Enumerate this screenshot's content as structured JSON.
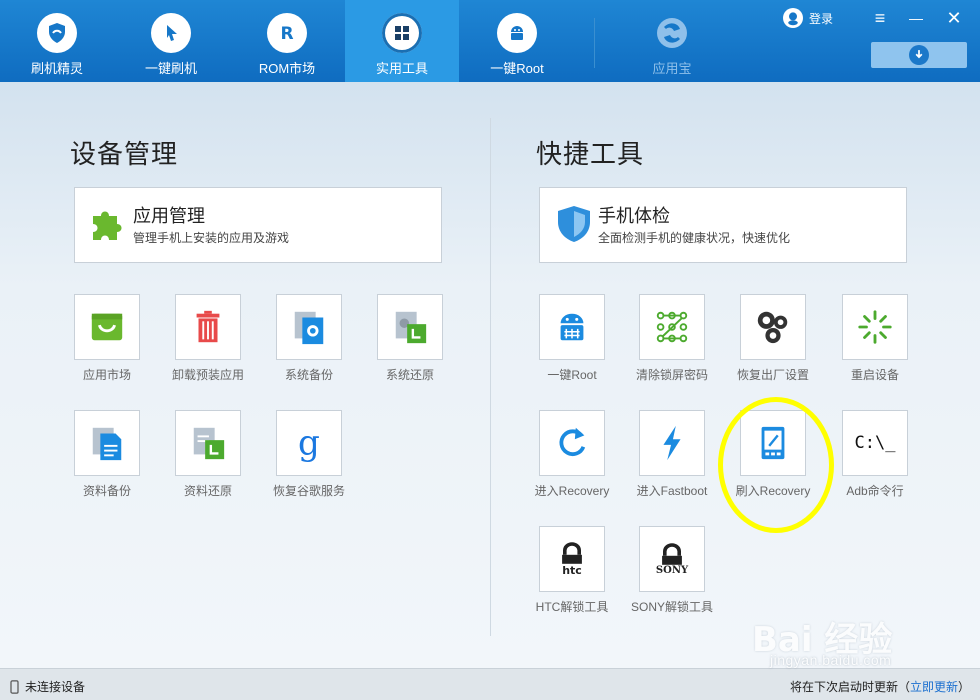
{
  "topnav": {
    "tabs": [
      {
        "label": "刷机精灵",
        "icon": "shield-icon"
      },
      {
        "label": "一键刷机",
        "icon": "cursor-icon"
      },
      {
        "label": "ROM市场",
        "icon": "rom-r-icon"
      },
      {
        "label": "实用工具",
        "icon": "grid-icon",
        "active": true
      },
      {
        "label": "一键Root",
        "icon": "android-icon"
      },
      {
        "label": "应用宝",
        "icon": "yingyongbao-icon"
      }
    ],
    "login": "登录",
    "window_controls": {
      "menu": "≡",
      "minimize": "—",
      "close": "✕"
    }
  },
  "left": {
    "title": "设备管理",
    "card": {
      "title": "应用管理",
      "subtitle": "管理手机上安装的应用及游戏",
      "icon": "puzzle-icon"
    },
    "tools": [
      {
        "label": "应用市场",
        "icon": "market-bag-icon"
      },
      {
        "label": "卸载预装应用",
        "icon": "trash-icon"
      },
      {
        "label": "系统备份",
        "icon": "system-backup-icon"
      },
      {
        "label": "系统还原",
        "icon": "system-restore-icon"
      },
      {
        "label": "资料备份",
        "icon": "data-backup-icon"
      },
      {
        "label": "资料还原",
        "icon": "data-restore-icon"
      },
      {
        "label": "恢复谷歌服务",
        "icon": "google-g-icon"
      }
    ]
  },
  "right": {
    "title": "快捷工具",
    "card": {
      "title": "手机体检",
      "subtitle": "全面检测手机的健康状况，快速优化",
      "icon": "shield-check-icon"
    },
    "tools": [
      {
        "label": "一键Root",
        "icon": "android-root-icon"
      },
      {
        "label": "清除锁屏密码",
        "icon": "pattern-lock-icon"
      },
      {
        "label": "恢复出厂设置",
        "icon": "gears-icon"
      },
      {
        "label": "重启设备",
        "icon": "loading-spinner-icon"
      },
      {
        "label": "进入Recovery",
        "icon": "refresh-icon"
      },
      {
        "label": "进入Fastboot",
        "icon": "lightning-icon"
      },
      {
        "label": "刷入Recovery",
        "icon": "tablet-edit-icon"
      },
      {
        "label": "Adb命令行",
        "icon": "cmd-prompt-icon",
        "glyph": "C:\\_"
      },
      {
        "label": "HTC解锁工具",
        "icon": "htc-lock-icon",
        "brand": "htc"
      },
      {
        "label": "SONY解锁工具",
        "icon": "sony-lock-icon",
        "brand": "SONY"
      }
    ]
  },
  "status": {
    "left_text": "未连接设备",
    "right_text": "将在下次启动时更新（",
    "right_link": "立即更新",
    "right_close": "）"
  },
  "watermark": {
    "logo": "Bai 经验",
    "url": "jingyan.baidu.com"
  },
  "colors": {
    "topbar": "#1677c8",
    "active_tab": "#2b9ae4",
    "highlight": "#ffff00",
    "link": "#1b6fcf"
  }
}
